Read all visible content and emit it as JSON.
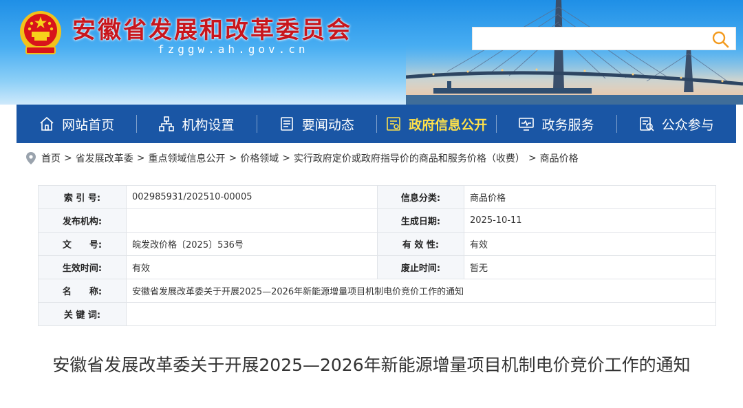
{
  "header": {
    "site_title": "安徽省发展和改革委员会",
    "site_domain": "fzggw.ah.gov.cn",
    "search": {
      "placeholder": "",
      "value": ""
    },
    "colors": {
      "title": "#c8161d",
      "nav": "#1a56a5",
      "active": "#ffe14a"
    }
  },
  "nav": {
    "items": [
      {
        "label": "网站首页",
        "icon": "home-icon"
      },
      {
        "label": "机构设置",
        "icon": "org-chart-icon"
      },
      {
        "label": "要闻动态",
        "icon": "news-icon"
      },
      {
        "label": "政府信息公开",
        "icon": "info-open-icon",
        "active": true
      },
      {
        "label": "政务服务",
        "icon": "monitor-icon"
      },
      {
        "label": "公众参与",
        "icon": "public-participation-icon"
      }
    ]
  },
  "breadcrumb": [
    "首页",
    "省发展改革委",
    "重点领域信息公开",
    "价格领域",
    "实行政府定价或政府指导价的商品和服务价格（收费）",
    "商品价格"
  ],
  "info": {
    "index_label": "索 引 号:",
    "index_value": "002985931/202510-00005",
    "category_label": "信息分类:",
    "category_value": "商品价格",
    "publisher_label": "发布机构:",
    "publisher_value": "",
    "date_label": "生成日期:",
    "date_value": "2025-10-11",
    "docno_label": "文　　号:",
    "docno_value": "皖发改价格〔2025〕536号",
    "validity_label": "有 效 性:",
    "validity_value": "有效",
    "effective_label": "生效时间:",
    "effective_value": "有效",
    "abolish_label": "废止时间:",
    "abolish_value": "暂无",
    "name_label": "名　　称:",
    "name_value": "安徽省发展改革委关于开展2025—2026年新能源增量项目机制电价竞价工作的通知",
    "keywords_label": "关 键 词:",
    "keywords_value": ""
  },
  "document": {
    "title": "安徽省发展改革委关于开展2025—2026年新能源增量项目机制电价竞价工作的通知"
  }
}
